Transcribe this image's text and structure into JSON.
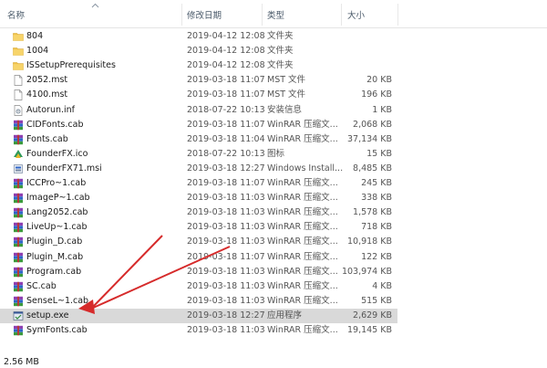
{
  "columns": {
    "name": "名称",
    "date": "修改日期",
    "type": "类型",
    "size": "大小"
  },
  "files": [
    {
      "name": "804",
      "date": "2019-04-12 12:08",
      "type": "文件夹",
      "size": "",
      "icon": "folder-icon"
    },
    {
      "name": "1004",
      "date": "2019-04-12 12:08",
      "type": "文件夹",
      "size": "",
      "icon": "folder-icon"
    },
    {
      "name": "ISSetupPrerequisites",
      "date": "2019-04-12 12:08",
      "type": "文件夹",
      "size": "",
      "icon": "folder-icon"
    },
    {
      "name": "2052.mst",
      "date": "2019-03-18 11:07",
      "type": "MST 文件",
      "size": "20 KB",
      "icon": "document-icon"
    },
    {
      "name": "4100.mst",
      "date": "2019-03-18 11:07",
      "type": "MST 文件",
      "size": "196 KB",
      "icon": "document-icon"
    },
    {
      "name": "Autorun.inf",
      "date": "2018-07-22 10:13",
      "type": "安装信息",
      "size": "1 KB",
      "icon": "settings-file-icon"
    },
    {
      "name": "CIDFonts.cab",
      "date": "2019-03-18 11:07",
      "type": "WinRAR 压缩文...",
      "size": "2,068 KB",
      "icon": "winrar-archive-icon"
    },
    {
      "name": "Fonts.cab",
      "date": "2019-03-18 11:04",
      "type": "WinRAR 压缩文...",
      "size": "37,134 KB",
      "icon": "winrar-archive-icon"
    },
    {
      "name": "FounderFX.ico",
      "date": "2018-07-22 10:13",
      "type": "图标",
      "size": "15 KB",
      "icon": "founder-ico-icon"
    },
    {
      "name": "FounderFX71.msi",
      "date": "2019-03-18 12:27",
      "type": "Windows Install...",
      "size": "8,485 KB",
      "icon": "installer-package-icon"
    },
    {
      "name": "ICCPro~1.cab",
      "date": "2019-03-18 11:07",
      "type": "WinRAR 压缩文...",
      "size": "245 KB",
      "icon": "winrar-archive-icon"
    },
    {
      "name": "ImageP~1.cab",
      "date": "2019-03-18 11:03",
      "type": "WinRAR 压缩文...",
      "size": "338 KB",
      "icon": "winrar-archive-icon"
    },
    {
      "name": "Lang2052.cab",
      "date": "2019-03-18 11:03",
      "type": "WinRAR 压缩文...",
      "size": "1,578 KB",
      "icon": "winrar-archive-icon"
    },
    {
      "name": "LiveUp~1.cab",
      "date": "2019-03-18 11:03",
      "type": "WinRAR 压缩文...",
      "size": "718 KB",
      "icon": "winrar-archive-icon"
    },
    {
      "name": "Plugin_D.cab",
      "date": "2019-03-18 11:03",
      "type": "WinRAR 压缩文...",
      "size": "10,918 KB",
      "icon": "winrar-archive-icon"
    },
    {
      "name": "Plugin_M.cab",
      "date": "2019-03-18 11:07",
      "type": "WinRAR 压缩文...",
      "size": "122 KB",
      "icon": "winrar-archive-icon"
    },
    {
      "name": "Program.cab",
      "date": "2019-03-18 11:03",
      "type": "WinRAR 压缩文...",
      "size": "103,974 KB",
      "icon": "winrar-archive-icon"
    },
    {
      "name": "SC.cab",
      "date": "2019-03-18 11:03",
      "type": "WinRAR 压缩文...",
      "size": "4 KB",
      "icon": "winrar-archive-icon"
    },
    {
      "name": "SenseL~1.cab",
      "date": "2019-03-18 11:03",
      "type": "WinRAR 压缩文...",
      "size": "515 KB",
      "icon": "winrar-archive-icon"
    },
    {
      "name": "setup.exe",
      "date": "2019-03-18 12:27",
      "type": "应用程序",
      "size": "2,629 KB",
      "icon": "setup-exe-icon",
      "selected": true
    },
    {
      "name": "SymFonts.cab",
      "date": "2019-03-18 11:03",
      "type": "WinRAR 压缩文...",
      "size": "19,145 KB",
      "icon": "winrar-archive-icon"
    }
  ],
  "status_bar": {
    "selection_size": "2.56 MB"
  },
  "colors": {
    "folder": "#f0c24a",
    "selected_row": "#d9d9d9",
    "annotation_arrow": "#d62b2b",
    "header_text": "#4a5a6a"
  }
}
